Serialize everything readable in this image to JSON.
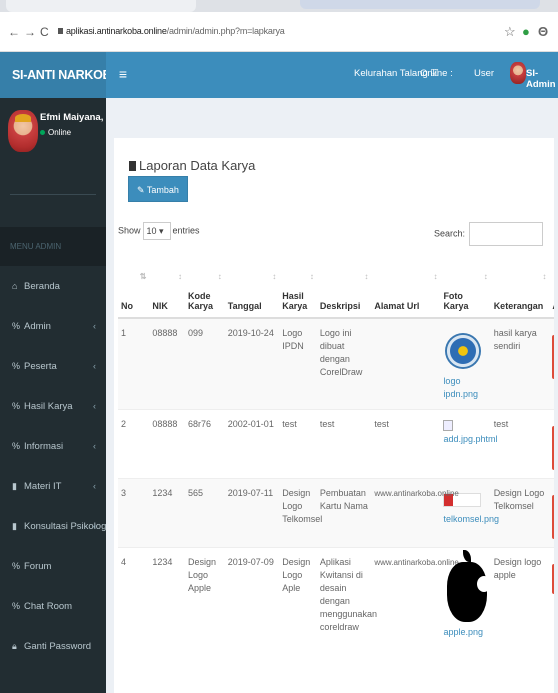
{
  "browser": {
    "back": "←",
    "forward": "→",
    "reload": "C",
    "url_domain": "aplikasi.antinarkoba.online",
    "url_path": "/admin/admin.php?m=lapkarya"
  },
  "sidebar": {
    "logo": "SI-ANTI NARKOBA",
    "user_name": "Efmi Maiyana, S.Kom., M",
    "user_status": "Online",
    "menu_header": "MENU ADMIN",
    "items": [
      {
        "label": "Beranda",
        "icon": "home-icon",
        "has_children": false
      },
      {
        "label": "Admin",
        "icon": "share-icon",
        "has_children": true
      },
      {
        "label": "Peserta",
        "icon": "share-icon",
        "has_children": true
      },
      {
        "label": "Hasil Karya",
        "icon": "share-icon",
        "has_children": true
      },
      {
        "label": "Informasi",
        "icon": "share-icon",
        "has_children": true
      },
      {
        "label": "Materi IT",
        "icon": "book-icon",
        "has_children": true
      },
      {
        "label": "Konsultasi Psikolog",
        "icon": "book-icon",
        "has_children": true
      },
      {
        "label": "Forum",
        "icon": "share-icon",
        "has_children": false
      },
      {
        "label": "Chat Room",
        "icon": "share-icon",
        "has_children": false
      },
      {
        "label": "Ganti Password",
        "icon": "lock-icon",
        "has_children": false
      }
    ]
  },
  "topnav": {
    "kelurahan": "Kelurahan Talang ☑",
    "online": "Online :",
    "user": "User",
    "admin": "SI-Admin"
  },
  "content": {
    "title": "Laporan Data Karya",
    "add_button": "Tambah Data",
    "show": "Show",
    "entries_value": "10",
    "entries": "entries",
    "search_label": "Search:"
  },
  "table": {
    "headers": [
      "No",
      "NIK",
      "Kode Karya",
      "Tanggal",
      "Hasil Karya",
      "Deskripsi",
      "Alamat Url",
      "Foto Karya",
      "Keterangan",
      "A"
    ],
    "rows": [
      {
        "no": "1",
        "nik": "08888",
        "kode": "099",
        "tanggal": "2019-10-24",
        "hasil": "Logo IPDN",
        "deskripsi": "Logo ini dibuat dengan CorelDraw",
        "url": "",
        "foto": "logo ipdn.png",
        "keterangan": "hasil karya sendiri"
      },
      {
        "no": "2",
        "nik": "08888",
        "kode": "68r76",
        "tanggal": "2002-01-01",
        "hasil": "test",
        "deskripsi": "test",
        "url": "test",
        "foto": "add.jpg.phtml",
        "keterangan": "test"
      },
      {
        "no": "3",
        "nik": "1234",
        "kode": "565",
        "tanggal": "2019-07-11",
        "hasil": "Design Logo Telkomsel",
        "deskripsi": "Pembuatan Kartu Nama",
        "url": "www.antinarkoba.online",
        "foto": "telkomsel.png",
        "keterangan": "Design Logo Telkomsel"
      },
      {
        "no": "4",
        "nik": "1234",
        "kode": "Design Logo Apple",
        "tanggal": "2019-07-09",
        "hasil": "Design Logo Aple",
        "deskripsi": "Aplikasi Kwitansi di desain dengan menggunakan coreldraw",
        "url": "www.antinarkoba.online",
        "foto": "apple.png",
        "keterangan": "Design logo apple"
      }
    ]
  },
  "colors": {
    "logo_bg": "#367fa9",
    "navbar_bg": "#3c8dbc",
    "sidebar_bg": "#222d32",
    "action_red": "#dd4b39"
  }
}
